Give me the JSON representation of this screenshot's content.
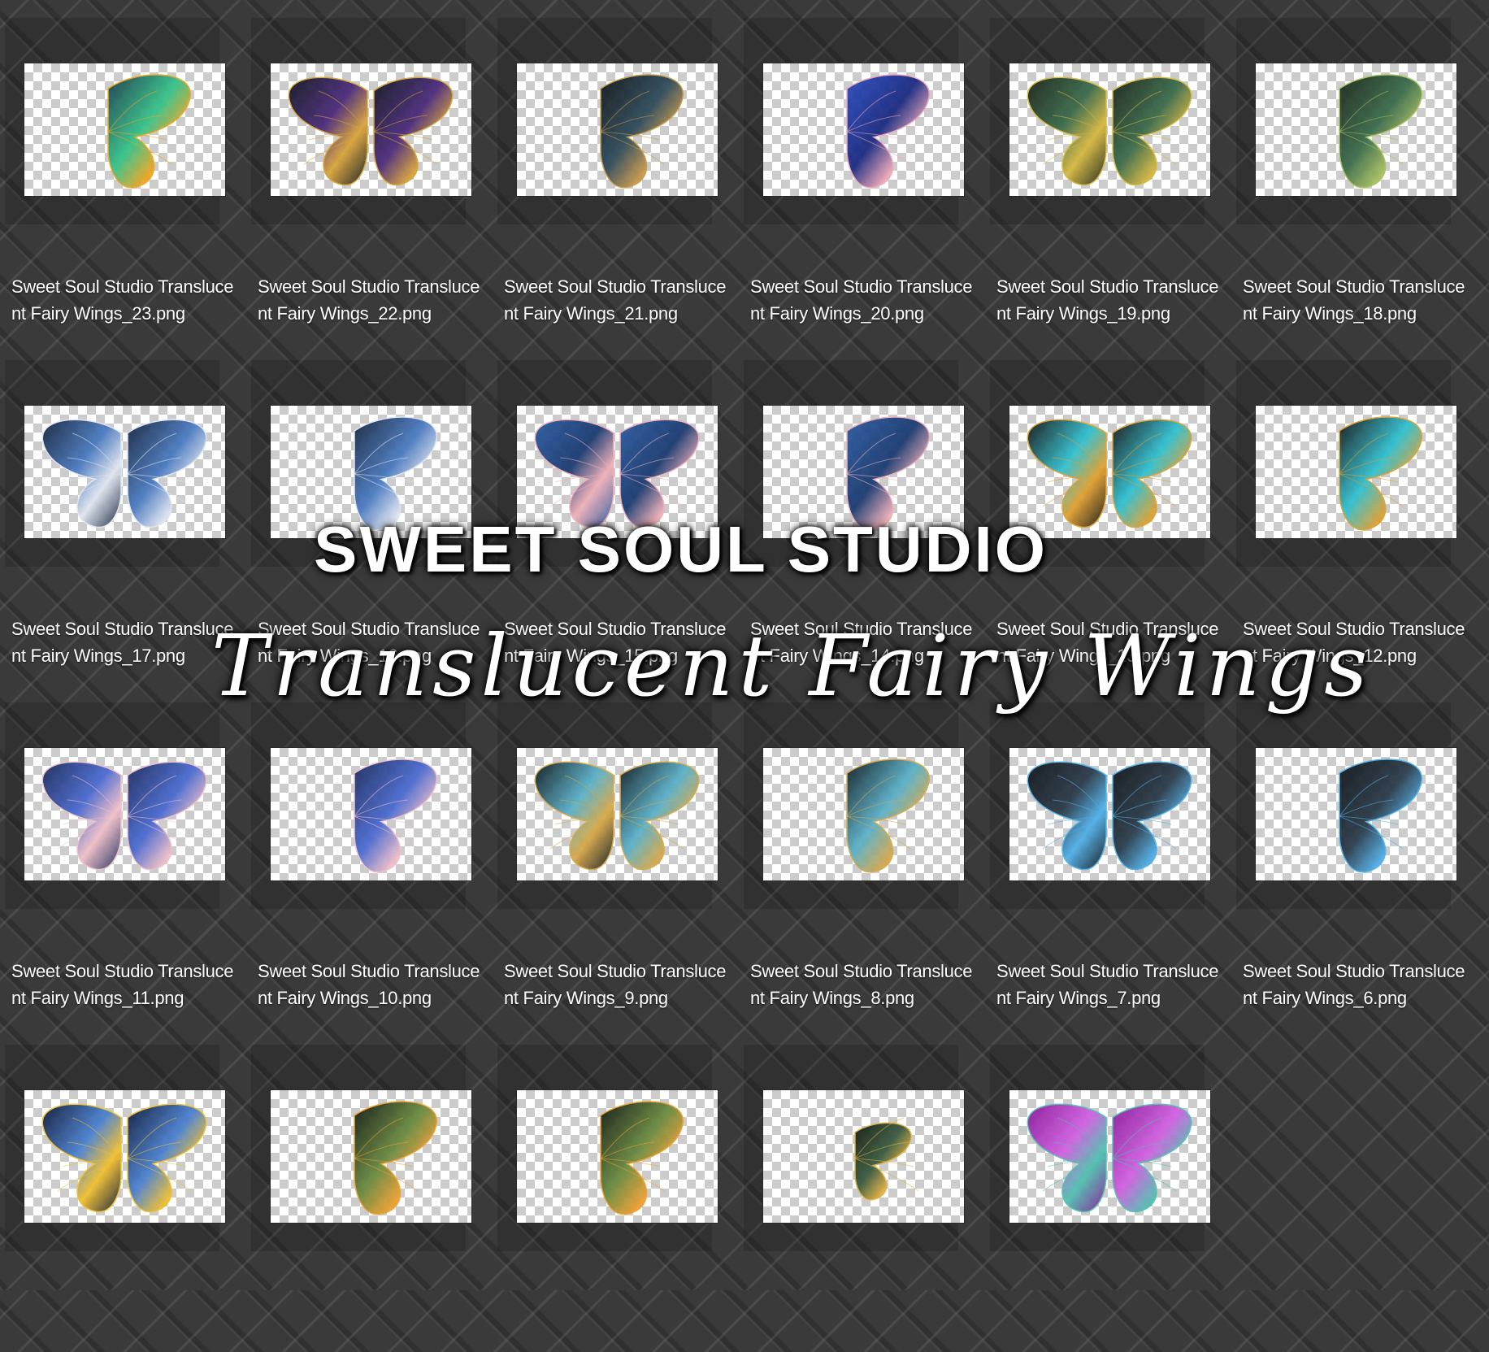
{
  "overlay": {
    "brand": "SWEET SOUL STUDIO",
    "subtitle": "Translucent Fairy Wings"
  },
  "files": [
    {
      "name": "Sweet Soul Studio Translucent Fairy Wings_23.png",
      "wing": "half",
      "colors": [
        "#1a3a4a",
        "#f2a51f",
        "#35c28a"
      ]
    },
    {
      "name": "Sweet Soul Studio Translucent Fairy Wings_22.png",
      "wing": "full",
      "colors": [
        "#111820",
        "#d9a43a",
        "#4a2a7a"
      ]
    },
    {
      "name": "Sweet Soul Studio Translucent Fairy Wings_21.png",
      "wing": "half",
      "colors": [
        "#0f1418",
        "#c99a4a",
        "#2e4a5a"
      ]
    },
    {
      "name": "Sweet Soul Studio Translucent Fairy Wings_20.png",
      "wing": "half",
      "colors": [
        "#2a4cc0",
        "#f0a8b8",
        "#1a2a80"
      ]
    },
    {
      "name": "Sweet Soul Studio Translucent Fairy Wings_19.png",
      "wing": "full",
      "colors": [
        "#1a2418",
        "#d6b840",
        "#3a6a4a"
      ]
    },
    {
      "name": "Sweet Soul Studio Translucent Fairy Wings_18.png",
      "wing": "half",
      "colors": [
        "#1a2418",
        "#a8c060",
        "#3a6a4a"
      ]
    },
    {
      "name": "Sweet Soul Studio Translucent Fairy Wings_17.png",
      "wing": "full",
      "colors": [
        "#16243e",
        "#e0e6f0",
        "#4a7ac0"
      ]
    },
    {
      "name": "Sweet Soul Studio Translucent Fairy Wings_16.png",
      "wing": "half",
      "colors": [
        "#16243e",
        "#e0e6f0",
        "#4a7ac0"
      ]
    },
    {
      "name": "Sweet Soul Studio Translucent Fairy Wings_15.png",
      "wing": "full",
      "colors": [
        "#2a5aa0",
        "#f0b0b8",
        "#1a3a70"
      ]
    },
    {
      "name": "Sweet Soul Studio Translucent Fairy Wings_14.png",
      "wing": "half",
      "colors": [
        "#2a5aa0",
        "#f0b0b8",
        "#1a3a70"
      ]
    },
    {
      "name": "Sweet Soul Studio Translucent Fairy Wings_13.png",
      "wing": "full",
      "colors": [
        "#141414",
        "#e0a030",
        "#30c0d0"
      ]
    },
    {
      "name": "Sweet Soul Studio Translucent Fairy Wings_12.png",
      "wing": "half",
      "colors": [
        "#141414",
        "#e0a030",
        "#30c0d0"
      ]
    },
    {
      "name": "Sweet Soul Studio Translucent Fairy Wings_11.png",
      "wing": "full",
      "colors": [
        "#1a2a5a",
        "#f0c0c8",
        "#4a6ad0"
      ]
    },
    {
      "name": "Sweet Soul Studio Translucent Fairy Wings_10.png",
      "wing": "half",
      "colors": [
        "#1a2a5a",
        "#f0c0c8",
        "#4a6ad0"
      ]
    },
    {
      "name": "Sweet Soul Studio Translucent Fairy Wings_9.png",
      "wing": "full",
      "colors": [
        "#0e1a20",
        "#d8a848",
        "#5ab0c8"
      ]
    },
    {
      "name": "Sweet Soul Studio Translucent Fairy Wings_8.png",
      "wing": "half",
      "colors": [
        "#0e1a20",
        "#d8a848",
        "#5ab0c8"
      ]
    },
    {
      "name": "Sweet Soul Studio Translucent Fairy Wings_7.png",
      "wing": "full",
      "colors": [
        "#101418",
        "#50b0e8",
        "#2a3a48"
      ]
    },
    {
      "name": "Sweet Soul Studio Translucent Fairy Wings_6.png",
      "wing": "half",
      "colors": [
        "#101418",
        "#50b0e8",
        "#2a3a48"
      ]
    },
    {
      "name": "",
      "wing": "full",
      "colors": [
        "#0e1a38",
        "#f0c030",
        "#4a80d0"
      ]
    },
    {
      "name": "",
      "wing": "half",
      "colors": [
        "#101810",
        "#f0a030",
        "#6a8a40"
      ]
    },
    {
      "name": "",
      "wing": "half",
      "colors": [
        "#101810",
        "#f0a030",
        "#6a8a40"
      ]
    },
    {
      "name": "",
      "wing": "small",
      "colors": [
        "#141a10",
        "#e0b040",
        "#3a5a40"
      ]
    },
    {
      "name": "",
      "wing": "full",
      "colors": [
        "#8a1a9a",
        "#50c0b0",
        "#d060e0"
      ]
    }
  ]
}
